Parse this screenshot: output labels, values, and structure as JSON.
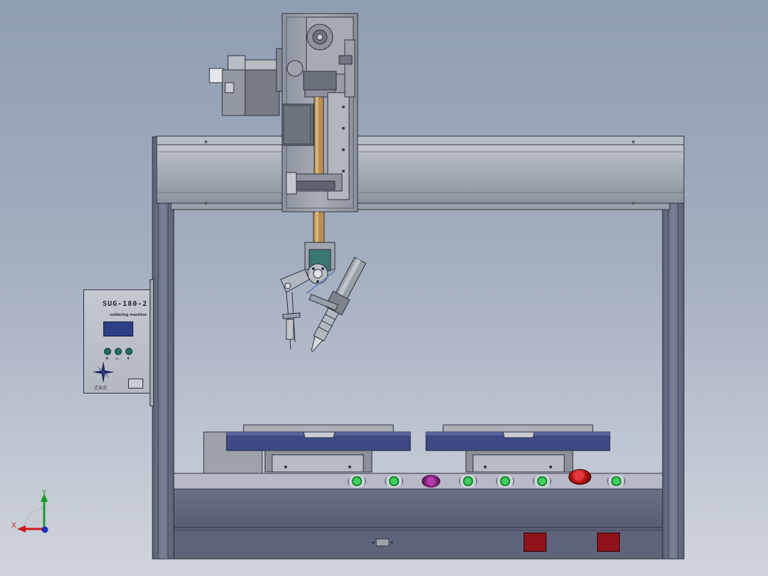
{
  "viewport": {
    "scene": "desktop soldering robot CAD model",
    "view": "front view",
    "background_top": "#8f9db3",
    "background_bottom": "#d0d4db"
  },
  "control_panel": {
    "model_label": "SUG-180-2",
    "subtitle": "soldering machine",
    "buttons": [
      "+",
      "–",
      "+"
    ],
    "brand_mark": "迁友达",
    "display_color": "#2e3f86",
    "button_color": "#1f6f5e"
  },
  "base_panel": {
    "button_colors": [
      "#2aa84a",
      "#2aa84a",
      "#8e2a88",
      "#2aa84a",
      "#2aa84a",
      "#2aa84a",
      "#c0141a",
      "#2aa84a"
    ],
    "indicator_color": "#8f1218"
  },
  "fixtures": {
    "tray_color": "#3e4a86"
  },
  "triad": {
    "x_label": "X",
    "y_label": "Y",
    "x_color": "#d01818",
    "y_color": "#1a9a2a",
    "z_color": "#1d2fb8"
  }
}
